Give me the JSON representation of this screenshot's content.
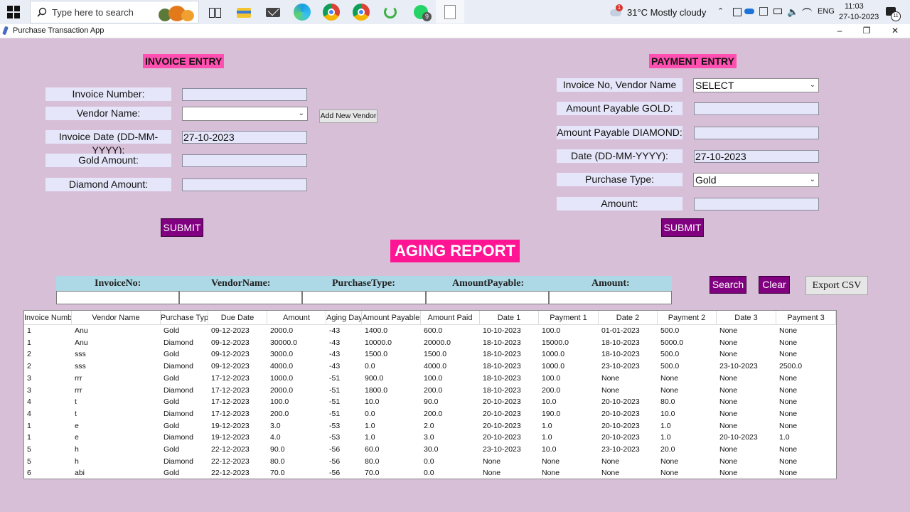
{
  "taskbar": {
    "search_placeholder": "Type here to search",
    "weather": "31°C  Mostly cloudy",
    "lang": "ENG",
    "time": "11:03",
    "date": "27-10-2023",
    "notif_badge": "1",
    "whatsapp_badge": "9",
    "notification_count": "11"
  },
  "window": {
    "title": "Purchase Transaction App"
  },
  "invoice": {
    "title": "INVOICE ENTRY",
    "labels": {
      "number": "Invoice Number:",
      "vendor": "Vendor Name:",
      "date": "Invoice Date (DD-MM-YYYY):",
      "gold": "Gold Amount:",
      "diamond": "Diamond Amount:"
    },
    "values": {
      "number": "",
      "vendor": "",
      "date": "27-10-2023",
      "gold": "",
      "diamond": ""
    },
    "add_vendor_label": "Add New Vendor",
    "submit_label": "SUBMIT"
  },
  "payment": {
    "title": "PAYMENT ENTRY",
    "labels": {
      "invoice_vendor": "Invoice No, Vendor Name",
      "payable_gold": "Amount Payable GOLD:",
      "payable_diamond": "Amount Payable DIAMOND:",
      "date": "Date (DD-MM-YYYY):",
      "purchase_type": "Purchase Type:",
      "amount": "Amount:"
    },
    "values": {
      "invoice_vendor": "SELECT",
      "payable_gold": "",
      "payable_diamond": "",
      "date": "27-10-2023",
      "purchase_type": "Gold",
      "amount": ""
    },
    "submit_label": "SUBMIT"
  },
  "aging": {
    "title": "AGING REPORT",
    "filters": [
      "InvoiceNo:",
      "VendorName:",
      "PurchaseType:",
      "AmountPayable:",
      "Amount:"
    ],
    "search_label": "Search",
    "clear_label": "Clear",
    "export_label": "Export CSV"
  },
  "table": {
    "columns": [
      "Invoice Numb",
      "Vendor Name",
      "Purchase Typ",
      "Due Date",
      "Amount",
      "Aging Day",
      "Amount Payable",
      "Amount Paid",
      "Date 1",
      "Payment 1",
      "Date 2",
      "Payment 2",
      "Date 3",
      "Payment 3"
    ],
    "rows": [
      [
        "1",
        "Anu",
        "Gold",
        "09-12-2023",
        "2000.0",
        "-43",
        "1400.0",
        "600.0",
        "10-10-2023",
        "100.0",
        "01-01-2023",
        "500.0",
        "None",
        "None"
      ],
      [
        "1",
        "Anu",
        "Diamond",
        "09-12-2023",
        "30000.0",
        "-43",
        "10000.0",
        "20000.0",
        "18-10-2023",
        "15000.0",
        "18-10-2023",
        "5000.0",
        "None",
        "None"
      ],
      [
        "2",
        "sss",
        "Gold",
        "09-12-2023",
        "3000.0",
        "-43",
        "1500.0",
        "1500.0",
        "18-10-2023",
        "1000.0",
        "18-10-2023",
        "500.0",
        "None",
        "None"
      ],
      [
        "2",
        "sss",
        "Diamond",
        "09-12-2023",
        "4000.0",
        "-43",
        "0.0",
        "4000.0",
        "18-10-2023",
        "1000.0",
        "23-10-2023",
        "500.0",
        "23-10-2023",
        "2500.0"
      ],
      [
        "3",
        "rrr",
        "Gold",
        "17-12-2023",
        "1000.0",
        "-51",
        "900.0",
        "100.0",
        "18-10-2023",
        "100.0",
        "None",
        "None",
        "None",
        "None"
      ],
      [
        "3",
        "rrr",
        "Diamond",
        "17-12-2023",
        "2000.0",
        "-51",
        "1800.0",
        "200.0",
        "18-10-2023",
        "200.0",
        "None",
        "None",
        "None",
        "None"
      ],
      [
        "4",
        "t",
        "Gold",
        "17-12-2023",
        "100.0",
        "-51",
        "10.0",
        "90.0",
        "20-10-2023",
        "10.0",
        "20-10-2023",
        "80.0",
        "None",
        "None"
      ],
      [
        "4",
        "t",
        "Diamond",
        "17-12-2023",
        "200.0",
        "-51",
        "0.0",
        "200.0",
        "20-10-2023",
        "190.0",
        "20-10-2023",
        "10.0",
        "None",
        "None"
      ],
      [
        "1",
        "e",
        "Gold",
        "19-12-2023",
        "3.0",
        "-53",
        "1.0",
        "2.0",
        "20-10-2023",
        "1.0",
        "20-10-2023",
        "1.0",
        "None",
        "None"
      ],
      [
        "1",
        "e",
        "Diamond",
        "19-12-2023",
        "4.0",
        "-53",
        "1.0",
        "3.0",
        "20-10-2023",
        "1.0",
        "20-10-2023",
        "1.0",
        "20-10-2023",
        "1.0"
      ],
      [
        "5",
        "h",
        "Gold",
        "22-12-2023",
        "90.0",
        "-56",
        "60.0",
        "30.0",
        "23-10-2023",
        "10.0",
        "23-10-2023",
        "20.0",
        "None",
        "None"
      ],
      [
        "5",
        "h",
        "Diamond",
        "22-12-2023",
        "80.0",
        "-56",
        "80.0",
        "0.0",
        "None",
        "None",
        "None",
        "None",
        "None",
        "None"
      ],
      [
        "6",
        "abi",
        "Gold",
        "22-12-2023",
        "70.0",
        "-56",
        "70.0",
        "0.0",
        "None",
        "None",
        "None",
        "None",
        "None",
        "None"
      ]
    ]
  }
}
